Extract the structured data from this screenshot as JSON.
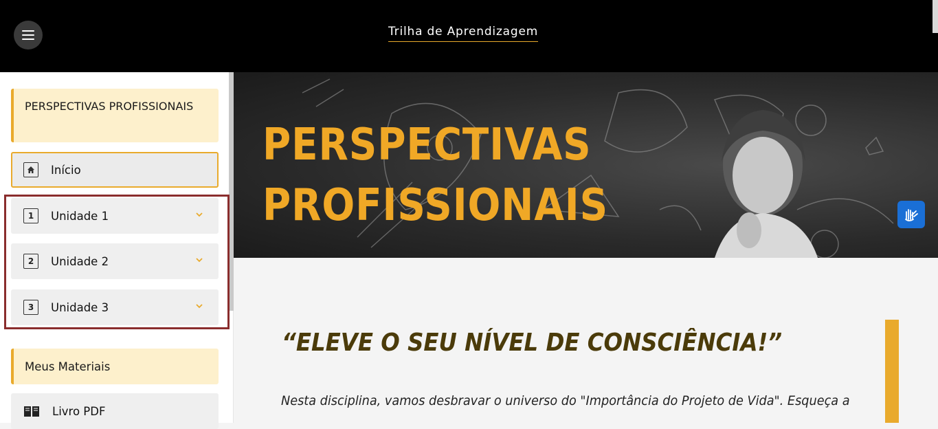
{
  "header": {
    "title": "Trilha de Aprendizagem",
    "menu_icon": "hamburger-menu-icon"
  },
  "sidebar": {
    "course_title": "PERSPECTIVAS PROFISSIONAIS",
    "home": {
      "label": "Início",
      "icon": "home-icon"
    },
    "units": [
      {
        "number": "1",
        "label": "Unidade 1"
      },
      {
        "number": "2",
        "label": "Unidade 2"
      },
      {
        "number": "3",
        "label": "Unidade 3"
      }
    ],
    "materials_heading": "Meus Materiais",
    "pdf": {
      "label": "Livro PDF",
      "icon": "book-icon"
    }
  },
  "banner": {
    "line1": "PERSPECTIVAS",
    "line2": "PROFISSIONAIS"
  },
  "content": {
    "quote": "“ELEVE O SEU NÍVEL DE CONSCIÊNCIA!”",
    "paragraph": "Nesta disciplina, vamos desbravar o universo do \"Importância do Projeto de Vida\". Esqueça a"
  },
  "colors": {
    "accent": "#e9aa2c",
    "highlight_border": "#8a2d2d",
    "accessibility_button": "#1a6fd6"
  }
}
